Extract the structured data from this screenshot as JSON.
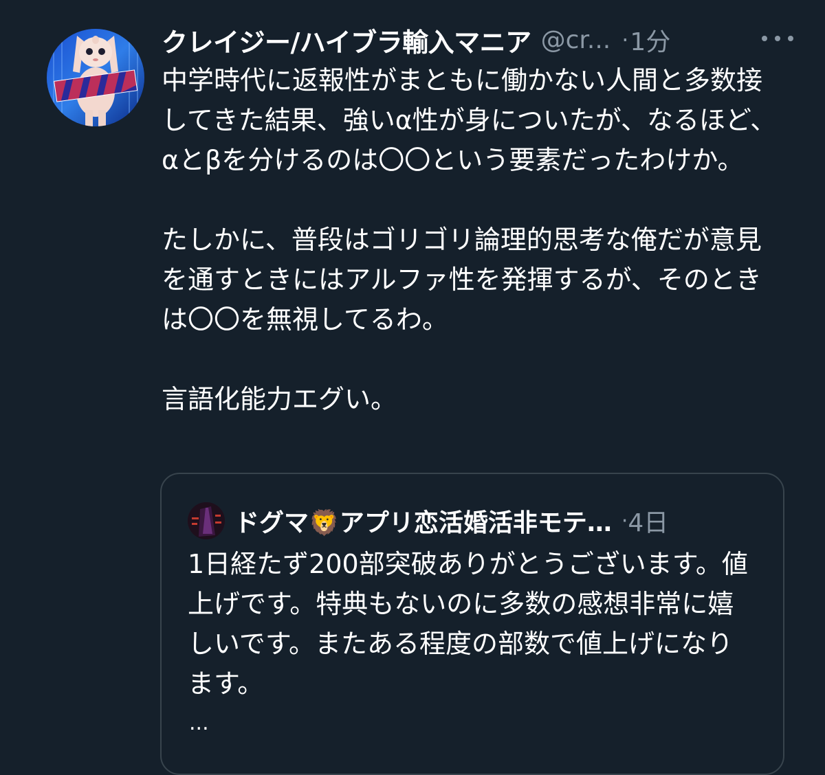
{
  "tweet": {
    "display_name": "クレイジー/ハイブラ輸入マニア",
    "handle": "@cr...",
    "separator": "·",
    "time": "1分",
    "more_icon": "more-horizontal-icon",
    "avatar_icon": "kewpie-doll-avatar",
    "paragraphs": [
      "中学時代に返報性がまともに働かない人間と多数接してきた結果、強いα性が身についたが、なるほど、αとβを分けるのは〇〇という要素だったわけか。",
      "たしかに、普段はゴリゴリ論理的思考な俺だが意見を通すときにはアルファ性を発揮するが、そのときは〇〇を無視してるわ。",
      "言語化能力エグい。"
    ]
  },
  "quote": {
    "display_name": "ドグマ🦁アプリ恋活婚活非モテ…",
    "separator": "·",
    "time": "4日",
    "avatar_icon": "dark-figure-avatar",
    "text": "1日経たず200部突破ありがとうございます。値上げです。特典もないのに多数の感想非常に嬉しいです。またある程度の部数で値上げになります。",
    "ellipsis": "..."
  },
  "colors": {
    "background": "#15202b",
    "text_primary": "#ffffff",
    "text_secondary": "#8b98a5",
    "border": "#38444d"
  }
}
